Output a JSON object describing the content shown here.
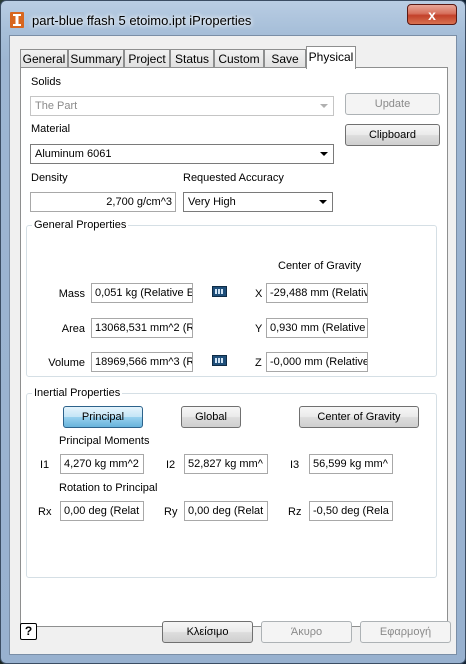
{
  "window": {
    "title": "part-blue ffash 5 etoimo.ipt iProperties",
    "close_label": "x"
  },
  "tabs": [
    {
      "label": "General"
    },
    {
      "label": "Summary"
    },
    {
      "label": "Project"
    },
    {
      "label": "Status"
    },
    {
      "label": "Custom"
    },
    {
      "label": "Save"
    },
    {
      "label": "Physical"
    }
  ],
  "solids": {
    "label": "Solids",
    "value": "The Part"
  },
  "update_label": "Update",
  "clipboard_label": "Clipboard",
  "material": {
    "label": "Material",
    "value": "Aluminum 6061"
  },
  "density": {
    "label": "Density",
    "value": "2,700 g/cm^3"
  },
  "accuracy": {
    "label": "Requested Accuracy",
    "value": "Very High"
  },
  "general": {
    "title": "General Properties",
    "mass_label": "Mass",
    "mass_value": "0,051 kg (Relative E",
    "area_label": "Area",
    "area_value": "13068,531 mm^2 (R",
    "volume_label": "Volume",
    "volume_value": "18969,566 mm^3 (R",
    "cog_title": "Center of Gravity",
    "x_label": "X",
    "x_value": "-29,488 mm (Relative",
    "y_label": "Y",
    "y_value": "0,930 mm (Relative E",
    "z_label": "Z",
    "z_value": "-0,000 mm (Relative"
  },
  "inertial": {
    "title": "Inertial Properties",
    "principal_label": "Principal",
    "global_label": "Global",
    "cog_label": "Center of Gravity",
    "moments_title": "Principal Moments",
    "i1_label": "I1",
    "i1_value": "4,270 kg mm^2",
    "i2_label": "I2",
    "i2_value": "52,827 kg mm^",
    "i3_label": "I3",
    "i3_value": "56,599 kg mm^",
    "rotation_title": "Rotation to Principal",
    "rx_label": "Rx",
    "rx_value": "0,00 deg (Relat",
    "ry_label": "Ry",
    "ry_value": "0,00 deg (Relat",
    "rz_label": "Rz",
    "rz_value": "-0,50 deg (Rela"
  },
  "footer": {
    "help_label": "?",
    "close_label": "Κλείσιμο",
    "cancel_label": "Άκυρο",
    "apply_label": "Εφαρμογή"
  }
}
